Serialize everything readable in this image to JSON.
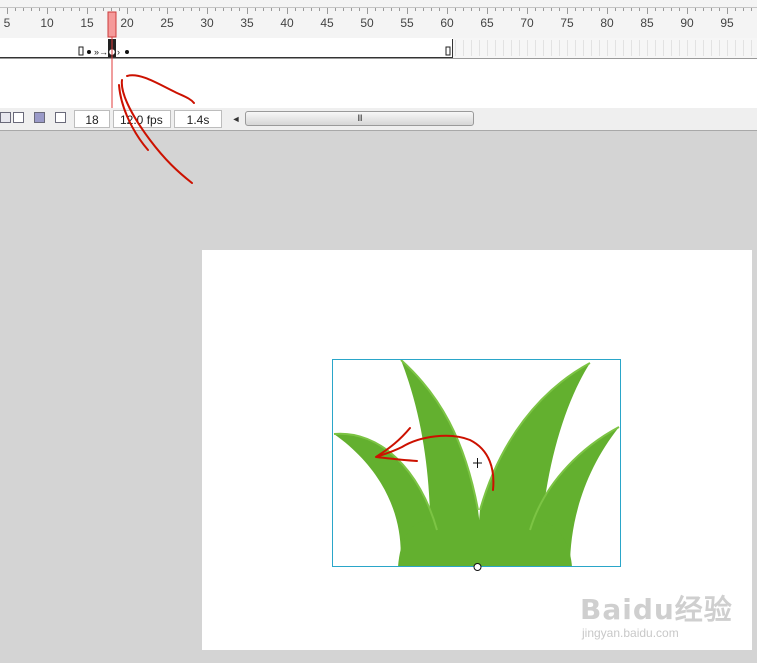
{
  "timeline": {
    "ruler_numbers": [
      "5",
      "10",
      "15",
      "20",
      "25",
      "30",
      "35",
      "40",
      "45",
      "50",
      "55",
      "60",
      "65",
      "70",
      "75",
      "80",
      "85",
      "90",
      "95"
    ],
    "playhead_frame": 18
  },
  "status_bar": {
    "current_frame": "18",
    "frame_rate": "12.0 fps",
    "elapsed_time": "1.4s",
    "scroll_left_arrow": "◄",
    "scroll_grip": "III"
  },
  "watermark": {
    "logo_text": "Baidu经验",
    "url_text": "jingyan.baidu.com"
  },
  "colors": {
    "grass_fill": "#63b02f",
    "grass_edge": "#7cc444",
    "playhead": "#e06060",
    "annotation_ink": "#cc1100",
    "selection_box": "#2aa6c9"
  },
  "icons": [
    "onion-skin-icon",
    "onion-skin-outline-icon",
    "edit-multiple-frames-icon",
    "modify-markers-icon"
  ]
}
